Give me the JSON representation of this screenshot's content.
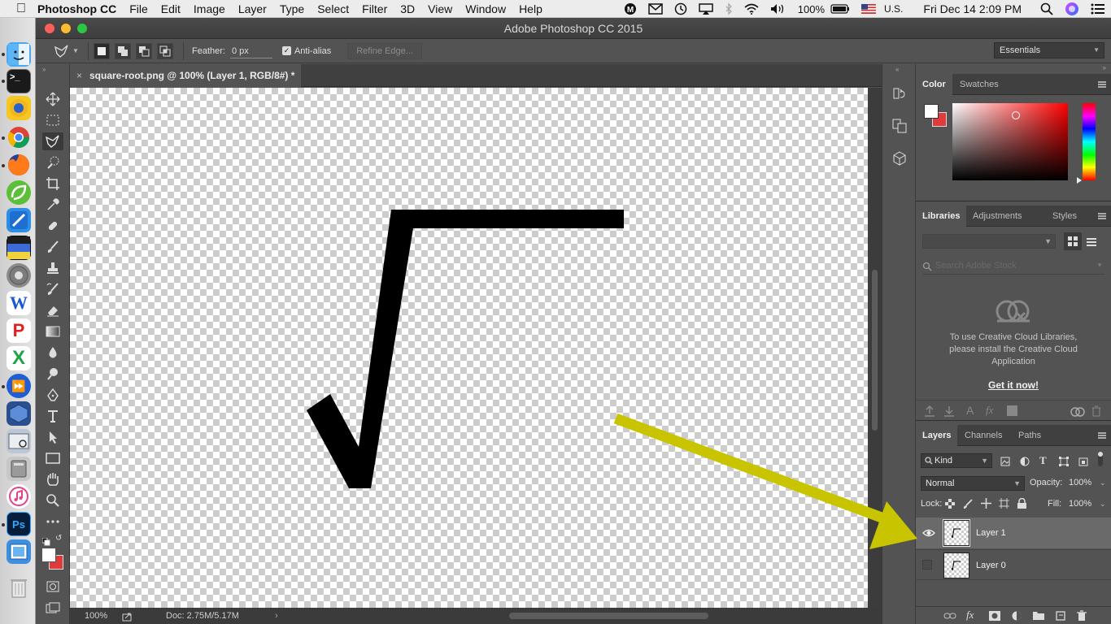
{
  "menubar": {
    "app": "Photoshop CC",
    "items": [
      "File",
      "Edit",
      "Image",
      "Layer",
      "Type",
      "Select",
      "Filter",
      "3D",
      "View",
      "Window",
      "Help"
    ],
    "battery": "100%",
    "input_source": "U.S.",
    "datetime": "Fri Dec 14  2:09 PM"
  },
  "window": {
    "title": "Adobe Photoshop CC 2015"
  },
  "options": {
    "feather_label": "Feather:",
    "feather_value": "0 px",
    "antialias_label": "Anti-alias",
    "antialias_checked": true,
    "refine_edge": "Refine Edge...",
    "workspace": "Essentials"
  },
  "document": {
    "tab_title": "square-root.png @ 100% (Layer 1, RGB/8#) *",
    "zoom": "100%",
    "doc_info": "Doc: 2.75M/5.17M"
  },
  "panels": {
    "color_tabs": [
      "Color",
      "Swatches"
    ],
    "libraries_tabs": [
      "Libraries",
      "Adjustments",
      "Styles"
    ],
    "library_search_placeholder": "Search Adobe Stock",
    "library_message": "To use Creative Cloud Libraries, please install the Creative Cloud Application",
    "library_link": "Get it now!",
    "layers_tabs": [
      "Layers",
      "Channels",
      "Paths"
    ],
    "kind": "Kind",
    "blend_mode": "Normal",
    "opacity_label": "Opacity:",
    "opacity_value": "100%",
    "lock_label": "Lock:",
    "fill_label": "Fill:",
    "fill_value": "100%",
    "layers": [
      {
        "name": "Layer 1",
        "visible": true,
        "selected": true
      },
      {
        "name": "Layer 0",
        "visible": false,
        "selected": false
      }
    ]
  },
  "colors": {
    "foreground": "#ffffff",
    "background": "#e03a3a",
    "annotation_arrow": "#c8c400"
  }
}
